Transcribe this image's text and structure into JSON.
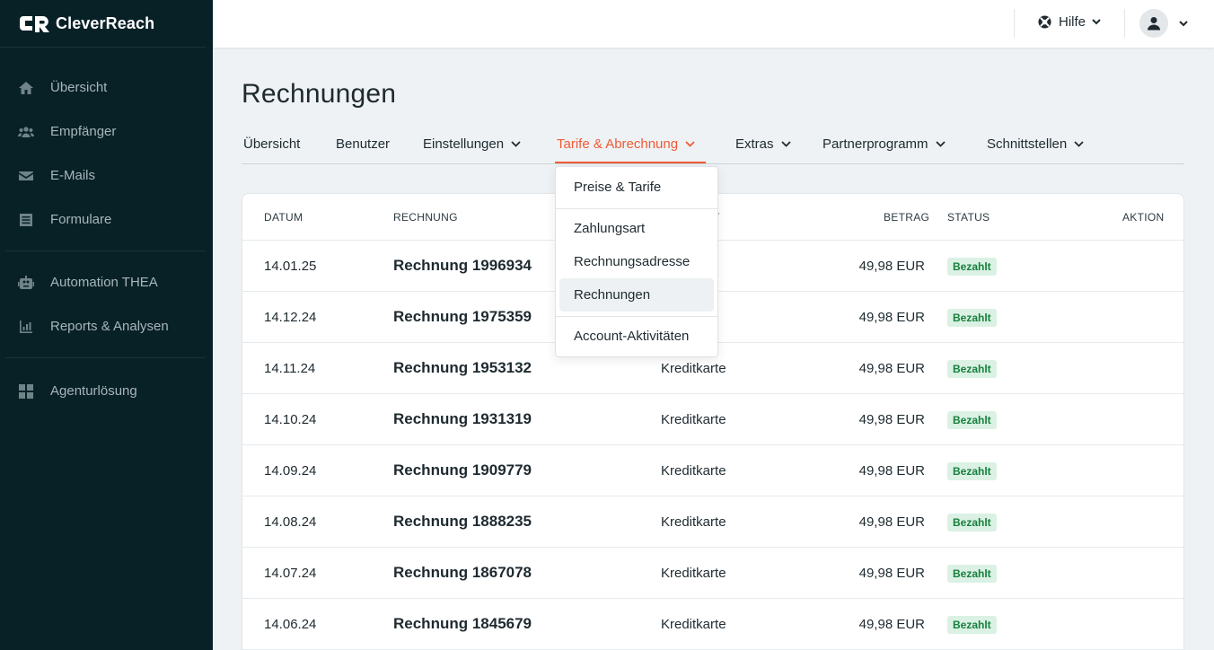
{
  "brand": {
    "name": "CleverReach"
  },
  "sidebar": {
    "groups": [
      {
        "items": [
          {
            "label": "Übersicht",
            "icon": "home-icon"
          },
          {
            "label": "Empfänger",
            "icon": "users-icon"
          },
          {
            "label": "E-Mails",
            "icon": "mail-icon"
          },
          {
            "label": "Formulare",
            "icon": "form-icon"
          }
        ]
      },
      {
        "items": [
          {
            "label": "Automation THEA",
            "icon": "robot-icon"
          },
          {
            "label": "Reports & Analysen",
            "icon": "chart-icon"
          }
        ]
      },
      {
        "items": [
          {
            "label": "Agenturlösung",
            "icon": "grid-icon"
          }
        ]
      }
    ]
  },
  "topbar": {
    "help_label": "Hilfe"
  },
  "page": {
    "title": "Rechnungen"
  },
  "tabs": [
    {
      "label": "Übersicht"
    },
    {
      "label": "Benutzer"
    },
    {
      "label": "Einstellungen"
    },
    {
      "label": "Tarife & Abrechnung"
    },
    {
      "label": "Extras"
    },
    {
      "label": "Partnerprogramm"
    },
    {
      "label": "Schnittstellen"
    }
  ],
  "dropdown": {
    "items": [
      {
        "label": "Preise & Tarife"
      },
      {
        "label": "Zahlungsart"
      },
      {
        "label": "Rechnungsadresse"
      },
      {
        "label": "Rechnungen"
      },
      {
        "label": "Account-Aktivitäten"
      }
    ]
  },
  "table": {
    "headers": {
      "date": "DATUM",
      "invoice": "RECHNUNG",
      "payment": "T",
      "amount": "BETRAG",
      "status": "STATUS",
      "action": "AKTION"
    },
    "rows": [
      {
        "date": "14.01.25",
        "invoice": "Rechnung 1996934",
        "payment": "karte",
        "amount": "49,98 EUR",
        "status": "Bezahlt"
      },
      {
        "date": "14.12.24",
        "invoice": "Rechnung 1975359",
        "payment": "karte",
        "amount": "49,98 EUR",
        "status": "Bezahlt"
      },
      {
        "date": "14.11.24",
        "invoice": "Rechnung 1953132",
        "payment": "Kreditkarte",
        "amount": "49,98 EUR",
        "status": "Bezahlt"
      },
      {
        "date": "14.10.24",
        "invoice": "Rechnung 1931319",
        "payment": "Kreditkarte",
        "amount": "49,98 EUR",
        "status": "Bezahlt"
      },
      {
        "date": "14.09.24",
        "invoice": "Rechnung 1909779",
        "payment": "Kreditkarte",
        "amount": "49,98 EUR",
        "status": "Bezahlt"
      },
      {
        "date": "14.08.24",
        "invoice": "Rechnung 1888235",
        "payment": "Kreditkarte",
        "amount": "49,98 EUR",
        "status": "Bezahlt"
      },
      {
        "date": "14.07.24",
        "invoice": "Rechnung 1867078",
        "payment": "Kreditkarte",
        "amount": "49,98 EUR",
        "status": "Bezahlt"
      },
      {
        "date": "14.06.24",
        "invoice": "Rechnung 1845679",
        "payment": "Kreditkarte",
        "amount": "49,98 EUR",
        "status": "Bezahlt"
      }
    ]
  },
  "colors": {
    "sidebar_bg": "#082127",
    "accent": "#f05a36",
    "badge_bg": "#daf1e4",
    "badge_text": "#17803d"
  }
}
